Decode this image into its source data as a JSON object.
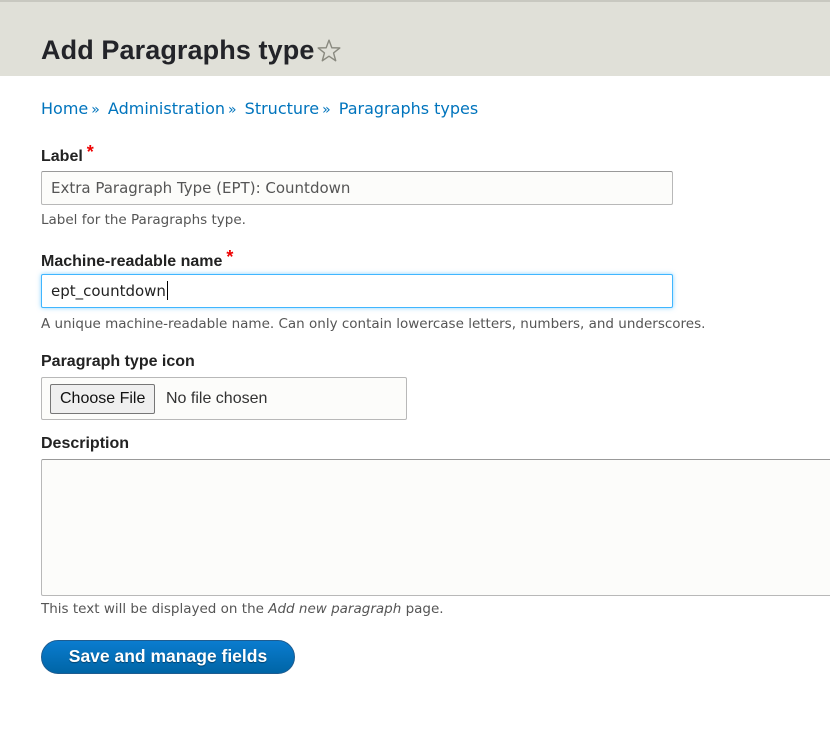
{
  "header": {
    "title": "Add Paragraphs type",
    "shortcut_icon": "star-icon"
  },
  "breadcrumb": [
    {
      "label": "Home"
    },
    {
      "label": "Administration"
    },
    {
      "label": "Structure"
    },
    {
      "label": "Paragraphs types"
    }
  ],
  "breadcrumb_separator": "»",
  "form": {
    "label_field": {
      "label": "Label",
      "required_marker": "*",
      "value": "Extra Paragraph Type (EPT): Countdown",
      "help": "Label for the Paragraphs type."
    },
    "machine_name_field": {
      "label": "Machine-readable name",
      "required_marker": "*",
      "value": "ept_countdown",
      "help": "A unique machine-readable name. Can only contain lowercase letters, numbers, and underscores."
    },
    "icon_field": {
      "label": "Paragraph type icon",
      "button_label": "Choose File",
      "status": "No file chosen"
    },
    "description_field": {
      "label": "Description",
      "value": "",
      "help_prefix": "This text will be displayed on the ",
      "help_emphasis": "Add new paragraph",
      "help_suffix": " page."
    },
    "submit_label": "Save and manage fields"
  },
  "colors": {
    "header_bg": "#e0e0d8",
    "link": "#0074bd",
    "required": "#ee0000",
    "primary_button": "#0071b8",
    "focus_border": "#40b6ff"
  }
}
